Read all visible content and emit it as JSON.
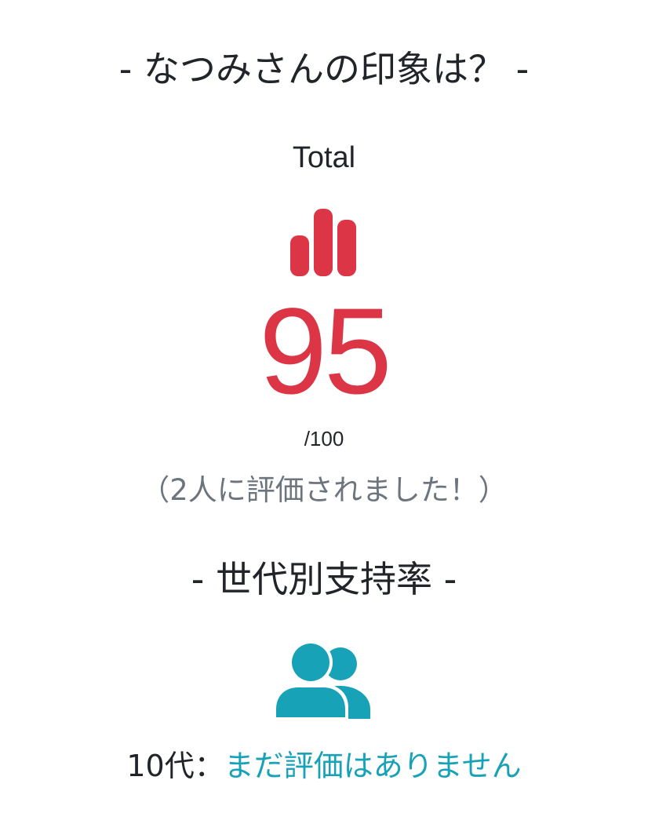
{
  "impression_section": {
    "title": "- なつみさんの印象は？ -",
    "total_label": "Total",
    "chart_icon": "bar-chart-icon",
    "score": "95",
    "max_score": "/100",
    "rated_count_text": "（2人に評価されました！）"
  },
  "generation_section": {
    "title": "- 世代別支持率 -",
    "users_icon": "users-icon",
    "rows": [
      {
        "age_label": "10代：",
        "value": "まだ評価はありません"
      }
    ]
  },
  "colors": {
    "score_red": "#dc3545",
    "teal_accent": "#17a2b8",
    "muted_gray": "#6c757d",
    "text_dark": "#212529"
  }
}
